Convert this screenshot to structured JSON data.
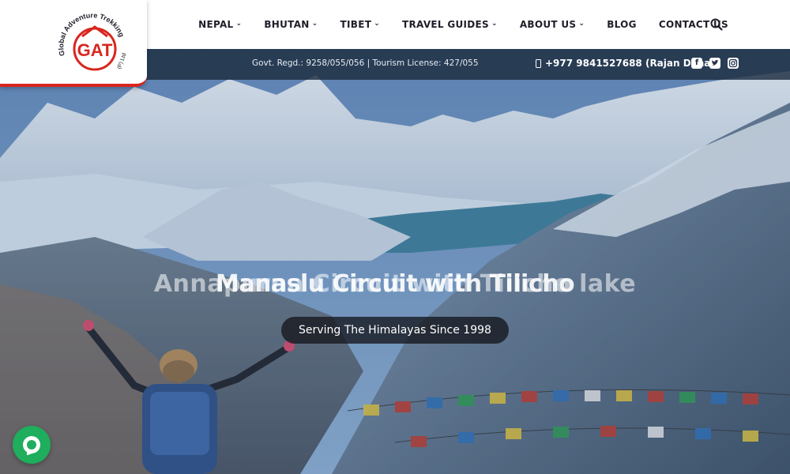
{
  "logo": {
    "brand_arc": "Global Adventure Trekking",
    "brand_suffix": "(P) Ltd",
    "monogram": "GAT"
  },
  "nav": {
    "items": [
      {
        "label": "NEPAL",
        "dropdown": true
      },
      {
        "label": "BHUTAN",
        "dropdown": true
      },
      {
        "label": "TIBET",
        "dropdown": true
      },
      {
        "label": "TRAVEL GUIDES",
        "dropdown": true
      },
      {
        "label": "ABOUT US",
        "dropdown": true
      },
      {
        "label": "BLOG",
        "dropdown": false
      },
      {
        "label": "CONTACT US",
        "dropdown": false
      }
    ],
    "search_icon": "search-icon"
  },
  "infobar": {
    "registration": "Govt. Regd.: 9258/055/056 | Tourism License: 427/055",
    "phone": "+977 9841527688 (Rajan Dahal)",
    "phone_icon": "mobile-phone-icon",
    "social": [
      "facebook-icon",
      "twitter-icon",
      "instagram-icon"
    ]
  },
  "hero": {
    "title_back": "Annapurna Circuit with Tilicho lake",
    "title_front": "Manaslu Circuit with Tilicho",
    "tagline": "Serving The Himalayas Since 1998"
  },
  "chat": {
    "icon": "chat-bubble-icon"
  },
  "colors": {
    "brand_red": "#d8261f",
    "nav_text": "#1e1e2a",
    "infobar_bg": "#1c2c40",
    "chat_green": "#1fae5d"
  }
}
